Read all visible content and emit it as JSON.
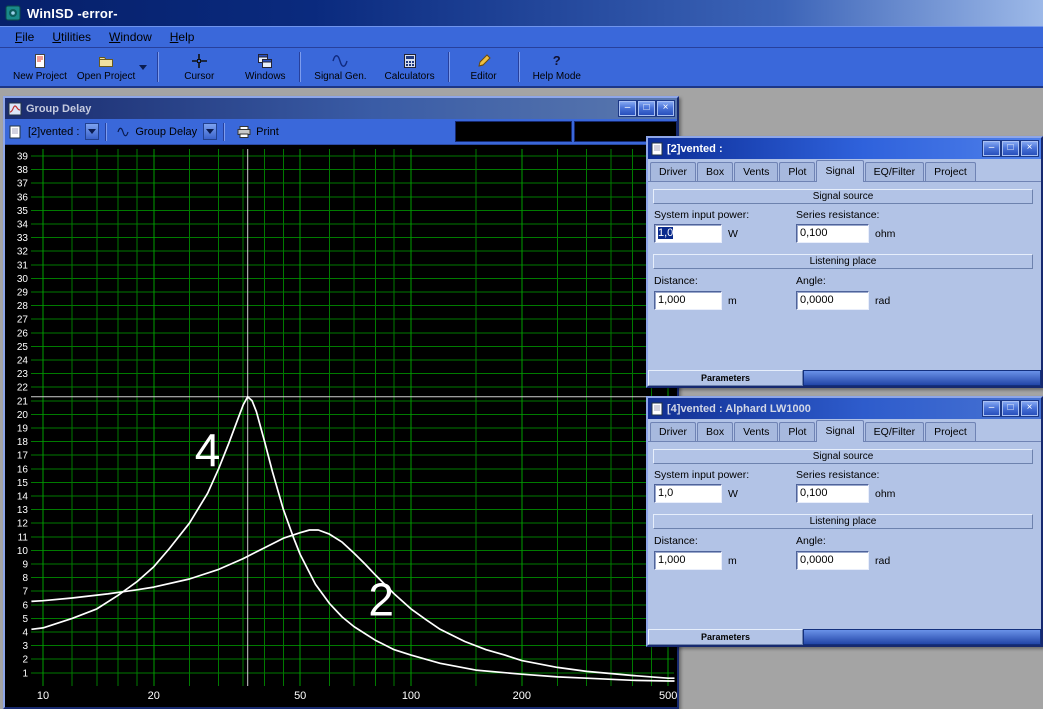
{
  "app": {
    "title": "WinISD -error-",
    "menu": [
      "File",
      "Utilities",
      "Window",
      "Help"
    ],
    "toolbar": {
      "new_project": "New Project",
      "open_project": "Open Project",
      "cursor": "Cursor",
      "windows": "Windows",
      "signal_gen": "Signal Gen.",
      "calculators": "Calculators",
      "editor": "Editor",
      "help_mode": "Help Mode"
    },
    "icons": {
      "minimize": "–",
      "maximize": "□",
      "close": "×",
      "help": "?"
    }
  },
  "group_delay": {
    "title": "Group Delay",
    "project_selector": "[2]vented :",
    "plot_selector": "Group Delay",
    "print_label": "Print",
    "readout1": "",
    "readout2": ""
  },
  "vented2": {
    "title": "[2]vented :",
    "tabs": [
      "Driver",
      "Box",
      "Vents",
      "Plot",
      "Signal",
      "EQ/Filter",
      "Project"
    ],
    "active_tab": "Signal",
    "groups": {
      "signal_source": "Signal source",
      "listening_place": "Listening place"
    },
    "fields": {
      "power": {
        "label": "System input power:",
        "value": "1,0",
        "unit": "W",
        "selected": true
      },
      "resistance": {
        "label": "Series resistance:",
        "value": "0,100",
        "unit": "ohm",
        "selected": false
      },
      "distance": {
        "label": "Distance:",
        "value": "1,000",
        "unit": "m",
        "selected": false
      },
      "angle": {
        "label": "Angle:",
        "value": "0,0000",
        "unit": "rad",
        "selected": false
      }
    },
    "parameters_label": "Parameters"
  },
  "vented4": {
    "title": "[4]vented : Alphard LW1000",
    "tabs": [
      "Driver",
      "Box",
      "Vents",
      "Plot",
      "Signal",
      "EQ/Filter",
      "Project"
    ],
    "active_tab": "Signal",
    "groups": {
      "signal_source": "Signal source",
      "listening_place": "Listening place"
    },
    "fields": {
      "power": {
        "label": "System input power:",
        "value": "1,0",
        "unit": "W",
        "selected": false
      },
      "resistance": {
        "label": "Series resistance:",
        "value": "0,100",
        "unit": "ohm",
        "selected": false
      },
      "distance": {
        "label": "Distance:",
        "value": "1,000",
        "unit": "m",
        "selected": false
      },
      "angle": {
        "label": "Angle:",
        "value": "0,0000",
        "unit": "rad",
        "selected": false
      }
    },
    "parameters_label": "Parameters"
  },
  "chart_data": {
    "type": "line",
    "title": "Group Delay",
    "xlabel": "",
    "ylabel": "",
    "x_scale": "log",
    "xlim": [
      9.3,
      520
    ],
    "ylim": [
      0,
      39
    ],
    "x_ticks": [
      10,
      20,
      50,
      100,
      200,
      500
    ],
    "x_grid": [
      10,
      12,
      14,
      16,
      18,
      20,
      25,
      30,
      35,
      40,
      45,
      50,
      60,
      70,
      80,
      90,
      100,
      150,
      200,
      250,
      300,
      350,
      400,
      450,
      500
    ],
    "y_ticks": [
      1,
      2,
      3,
      4,
      5,
      6,
      7,
      8,
      9,
      10,
      11,
      12,
      13,
      14,
      15,
      16,
      17,
      18,
      19,
      20,
      21,
      22,
      23,
      24,
      25,
      26,
      27,
      28,
      29,
      30,
      31,
      32,
      33,
      34,
      35,
      36,
      37,
      38,
      39
    ],
    "cursor": {
      "freq": 36,
      "value": 21.3
    },
    "colors": {
      "background": "#000000",
      "grid": "#007a00",
      "grid_major": "#009e00",
      "curve": "#ffffff",
      "cursor": "#cfcfcf",
      "text": "#ffffff"
    },
    "series": [
      {
        "name": "4",
        "label_freq": 28,
        "label_value": 17.4,
        "x": [
          9.3,
          10,
          12,
          14,
          16,
          18,
          20,
          22,
          25,
          28,
          30,
          32,
          34,
          35,
          36,
          37,
          38,
          40,
          42,
          45,
          48,
          50,
          55,
          60,
          65,
          70,
          80,
          90,
          100,
          120,
          150,
          200,
          250,
          300,
          400,
          500,
          520
        ],
        "y": [
          4.2,
          4.3,
          5.0,
          5.7,
          6.7,
          7.7,
          8.8,
          10.1,
          12.0,
          14.2,
          16.0,
          17.9,
          19.8,
          20.7,
          21.3,
          21.0,
          20.2,
          18.0,
          15.8,
          13.0,
          10.9,
          9.7,
          7.5,
          6.1,
          5.1,
          4.4,
          3.4,
          2.7,
          2.3,
          1.7,
          1.2,
          0.9,
          0.7,
          0.6,
          0.45,
          0.4,
          0.4
        ]
      },
      {
        "name": "2",
        "label_freq": 83,
        "label_value": 6.4,
        "x": [
          9.3,
          10,
          12,
          15,
          18,
          20,
          25,
          30,
          35,
          40,
          45,
          50,
          53,
          56,
          60,
          65,
          70,
          75,
          80,
          90,
          100,
          110,
          120,
          140,
          160,
          180,
          200,
          250,
          300,
          400,
          500,
          520
        ],
        "y": [
          6.25,
          6.3,
          6.5,
          6.8,
          7.1,
          7.3,
          7.9,
          8.6,
          9.4,
          10.2,
          10.9,
          11.3,
          11.5,
          11.5,
          11.2,
          10.6,
          9.8,
          9.0,
          8.2,
          6.8,
          5.7,
          4.9,
          4.2,
          3.3,
          2.7,
          2.3,
          1.9,
          1.4,
          1.1,
          0.8,
          0.6,
          0.6
        ]
      }
    ]
  }
}
